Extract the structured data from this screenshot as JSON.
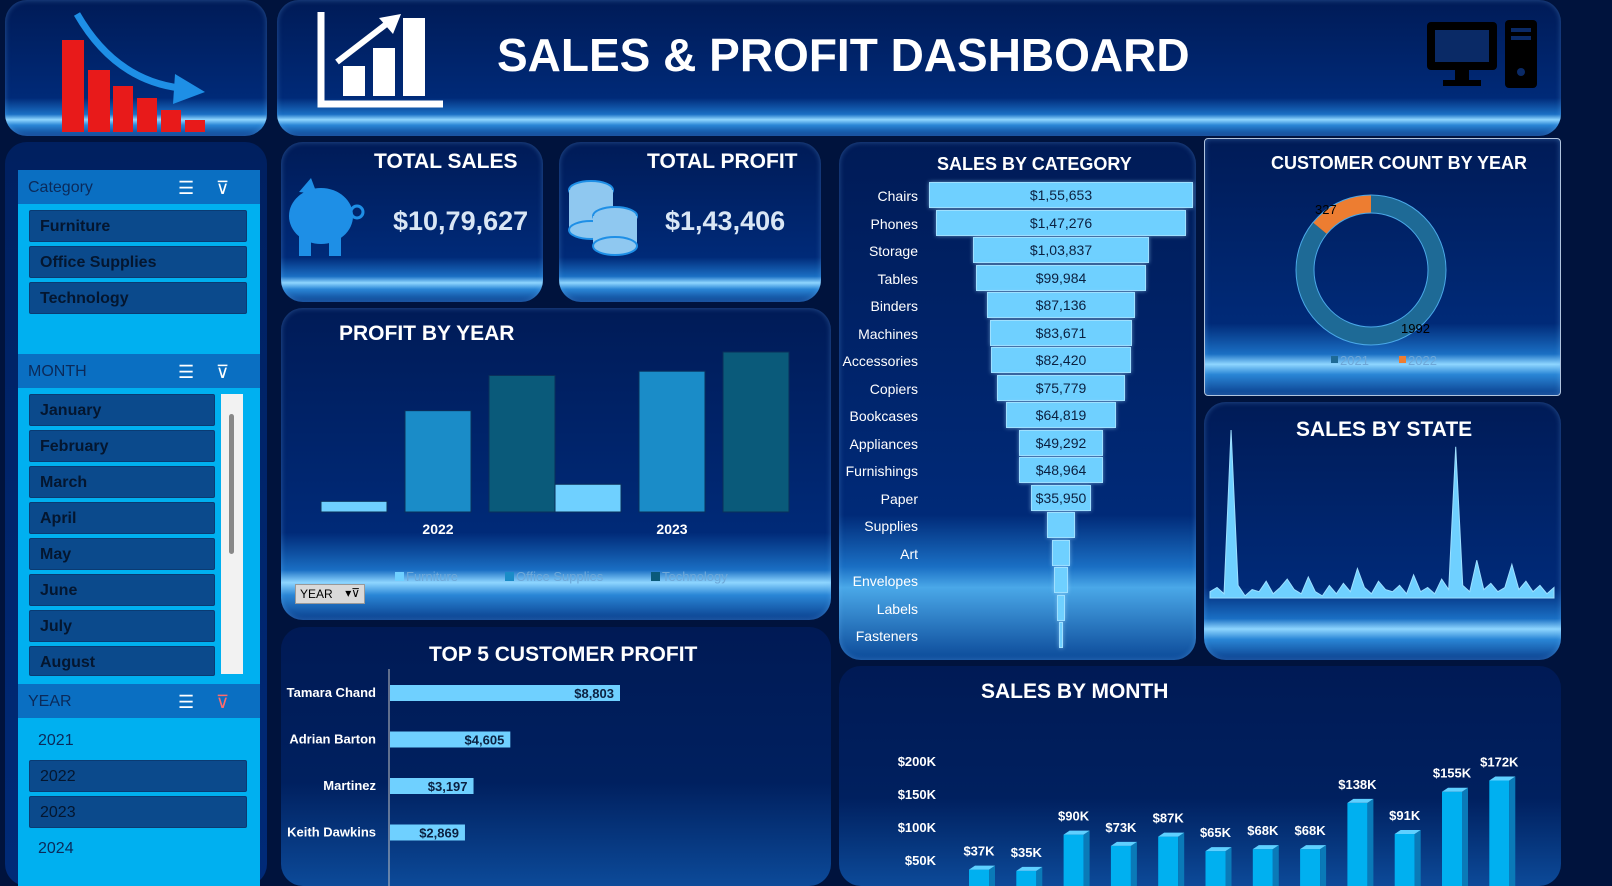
{
  "header": {
    "title": "SALES & PROFIT DASHBOARD"
  },
  "slicers": {
    "category": {
      "title": "Category",
      "items": [
        "Furniture",
        "Office Supplies",
        "Technology"
      ]
    },
    "month": {
      "title": "MONTH",
      "items": [
        "January",
        "February",
        "March",
        "April",
        "May",
        "June",
        "July",
        "August"
      ]
    },
    "year": {
      "title": "YEAR",
      "items": [
        "2021",
        "2022",
        "2023",
        "2024"
      ],
      "selected": [
        "2022",
        "2023"
      ]
    }
  },
  "kpis": {
    "total_sales": {
      "title": "TOTAL SALES",
      "value": "$10,79,627"
    },
    "total_profit": {
      "title": "TOTAL PROFIT",
      "value": "$1,43,406"
    }
  },
  "filter_button": {
    "label": "YEAR"
  },
  "colors": {
    "light": "#6fd0ff",
    "mid": "#1a8cc8",
    "dark": "#0a5a7a",
    "orange": "#ed7d31",
    "accent": "#00b0f0"
  },
  "chart_data": [
    {
      "id": "profit_by_year",
      "type": "bar",
      "title": "PROFIT BY YEAR",
      "categories": [
        "2022",
        "2023"
      ],
      "series": [
        {
          "name": "Furniture",
          "values": [
            1000,
            2600
          ]
        },
        {
          "name": "Office Supplies",
          "values": [
            9500,
            13200
          ]
        },
        {
          "name": "Technology",
          "values": [
            12800,
            15000
          ]
        }
      ]
    },
    {
      "id": "sales_by_category",
      "type": "bar",
      "title": "SALES BY CATEGORY",
      "categories": [
        "Chairs",
        "Phones",
        "Storage",
        "Tables",
        "Binders",
        "Machines",
        "Accessories",
        "Copiers",
        "Bookcases",
        "Appliances",
        "Furnishings",
        "Paper",
        "Supplies",
        "Art",
        "Envelopes",
        "Labels",
        "Fasteners"
      ],
      "values": [
        155653,
        147276,
        103837,
        99984,
        87136,
        83671,
        82420,
        75779,
        64819,
        49292,
        48964,
        35950,
        16000,
        11000,
        8000,
        5000,
        1500
      ],
      "labels": [
        "$1,55,653",
        "$1,47,276",
        "$1,03,837",
        "$99,984",
        "$87,136",
        "$83,671",
        "$82,420",
        "$75,779",
        "$64,819",
        "$49,292",
        "$48,964",
        "$35,950",
        "",
        "",
        "",
        "",
        ""
      ]
    },
    {
      "id": "customer_count_by_year",
      "type": "pie",
      "title": "CUSTOMER COUNT BY YEAR",
      "categories": [
        "2021",
        "2022"
      ],
      "values": [
        1992,
        327
      ]
    },
    {
      "id": "sales_by_state",
      "type": "area",
      "title": "SALES BY STATE",
      "values": [
        3,
        5,
        2,
        80,
        6,
        1,
        4,
        3,
        8,
        2,
        5,
        9,
        4,
        2,
        10,
        3,
        1,
        6,
        2,
        7,
        3,
        14,
        5,
        2,
        8,
        4,
        3,
        6,
        2,
        11,
        3,
        5,
        2,
        9,
        4,
        72,
        6,
        3,
        18,
        4,
        7,
        3,
        5,
        16,
        4,
        8,
        3,
        6,
        2,
        5
      ]
    },
    {
      "id": "top5_customer_profit",
      "type": "bar",
      "title": "TOP 5 CUSTOMER PROFIT",
      "categories": [
        "Tamara Chand",
        "Adrian Barton",
        "Martinez",
        "Keith Dawkins"
      ],
      "values": [
        8803,
        4605,
        3197,
        2869
      ],
      "labels": [
        "$8,803",
        "$4,605",
        "$3,197",
        "$2,869"
      ]
    },
    {
      "id": "sales_by_month",
      "type": "bar",
      "title": "SALES BY MONTH",
      "values": [
        37,
        35,
        90,
        73,
        87,
        65,
        68,
        68,
        138,
        91,
        155,
        172
      ],
      "labels": [
        "$37K",
        "$35K",
        "$90K",
        "$73K",
        "$87K",
        "$65K",
        "$68K",
        "$68K",
        "$138K",
        "$91K",
        "$155K",
        "$172K"
      ],
      "yticks": [
        "$200K",
        "$150K",
        "$100K",
        "$50K"
      ],
      "ylim": [
        0,
        200
      ]
    }
  ]
}
